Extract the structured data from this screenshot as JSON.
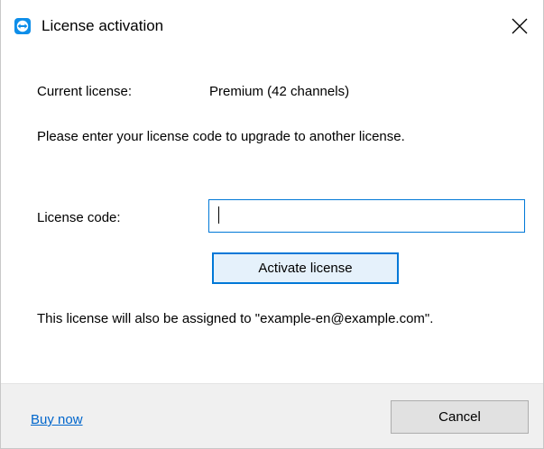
{
  "window": {
    "title": "License activation",
    "app_icon": "teamviewer-icon",
    "close_icon": "close-icon"
  },
  "license": {
    "current_label": "Current license:",
    "current_value": "Premium (42 channels)",
    "intro_text": "Please enter your license code to upgrade to another license.",
    "code_label": "License code:",
    "code_value": "",
    "code_placeholder": "",
    "activate_label": "Activate license",
    "assignment_text": "This license will also be assigned to \"example-en@example.com\"."
  },
  "footer": {
    "buy_now_label": "Buy now",
    "cancel_label": "Cancel"
  },
  "colors": {
    "accent": "#0078d7",
    "link": "#0066cc",
    "footer_bg": "#f0f0f0",
    "app_icon_blue": "#0e8ee9"
  }
}
